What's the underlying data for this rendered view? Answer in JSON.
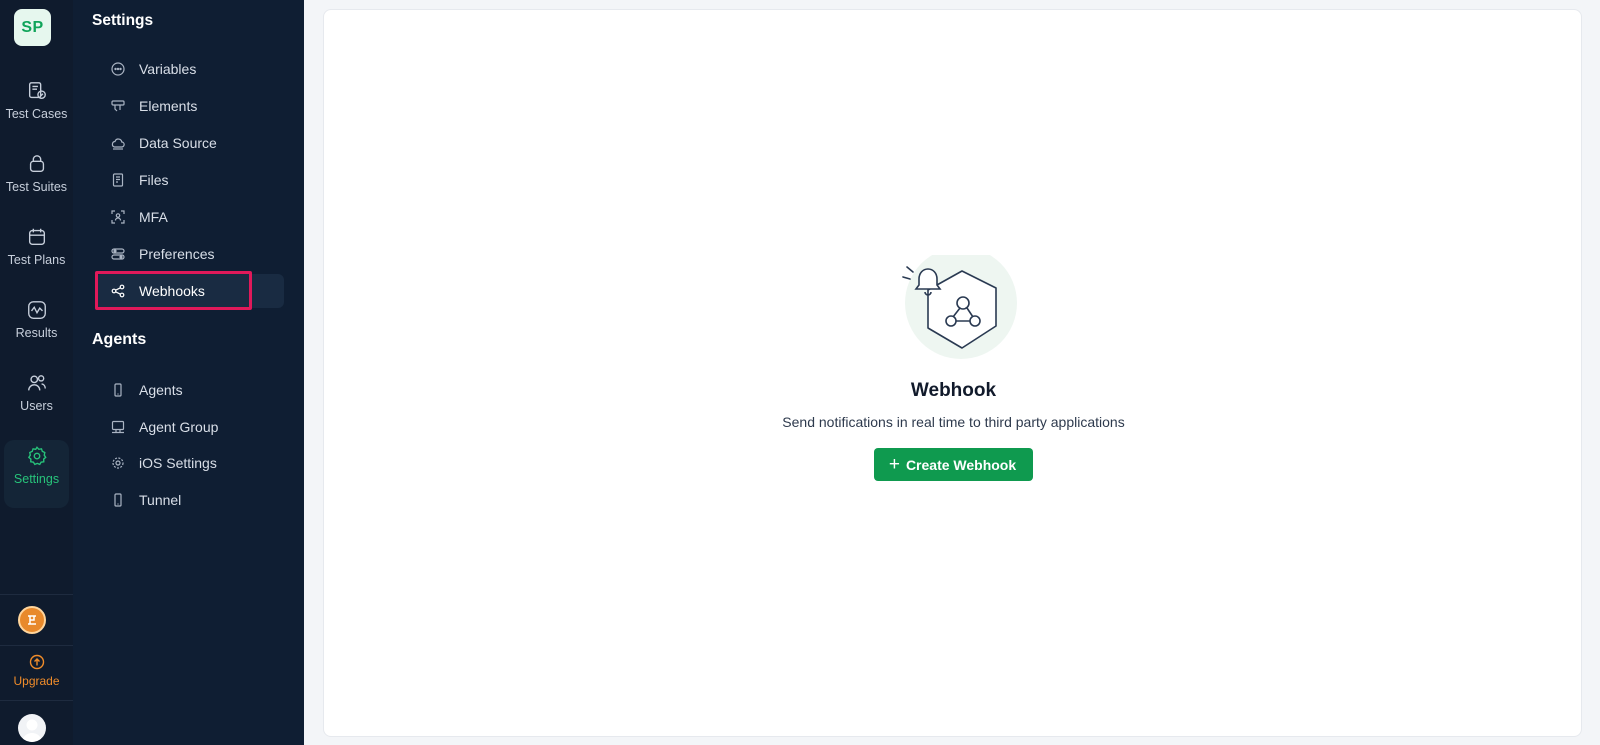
{
  "app": {
    "logo_initials": "SP"
  },
  "rail": {
    "items": [
      {
        "label": "Test Cases",
        "icon": "test-cases-icon"
      },
      {
        "label": "Test Suites",
        "icon": "test-suites-icon"
      },
      {
        "label": "Test Plans",
        "icon": "test-plans-icon"
      },
      {
        "label": "Results",
        "icon": "results-icon"
      },
      {
        "label": "Users",
        "icon": "users-icon"
      },
      {
        "label": "Settings",
        "icon": "settings-icon",
        "active": true
      }
    ],
    "upgrade_label": "Upgrade"
  },
  "panel": {
    "settings_title": "Settings",
    "settings_items": [
      {
        "label": "Variables",
        "icon": "variables-icon"
      },
      {
        "label": "Elements",
        "icon": "elements-icon"
      },
      {
        "label": "Data Source",
        "icon": "cloud-icon"
      },
      {
        "label": "Files",
        "icon": "file-icon"
      },
      {
        "label": "MFA",
        "icon": "mfa-icon"
      },
      {
        "label": "Preferences",
        "icon": "preferences-icon"
      },
      {
        "label": "Webhooks",
        "icon": "share-icon",
        "active": true
      }
    ],
    "agents_title": "Agents",
    "agents_items": [
      {
        "label": "Agents",
        "icon": "mobile-icon"
      },
      {
        "label": "Agent Group",
        "icon": "desktop-icon"
      },
      {
        "label": "iOS Settings",
        "icon": "gear-icon"
      },
      {
        "label": "Tunnel",
        "icon": "mobile-icon"
      }
    ]
  },
  "main": {
    "empty_title": "Webhook",
    "empty_description": "Send notifications in real time to third party applications",
    "create_button": "Create Webhook"
  },
  "colors": {
    "accent": "#0f9a4f",
    "rail_bg": "#0f1b2d",
    "panel_bg": "#0f1e33",
    "upgrade": "#f08c2a",
    "highlight": "#e0195a"
  }
}
